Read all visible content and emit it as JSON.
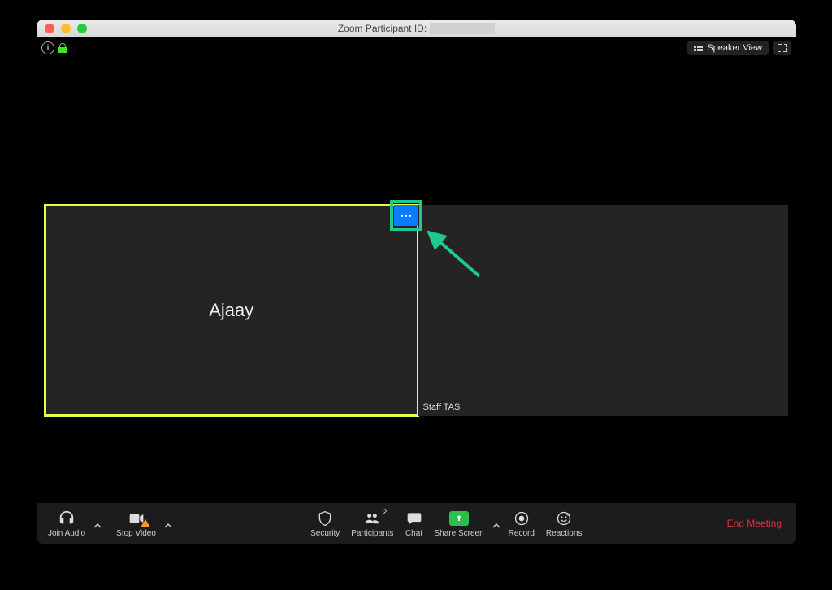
{
  "window": {
    "title_prefix": "Zoom Participant ID:"
  },
  "topbar": {
    "speaker_view_label": "Speaker View"
  },
  "participants": {
    "active": {
      "name": "Ajaay"
    },
    "other": {
      "name": "Staff TAS"
    },
    "count": "2"
  },
  "toolbar": {
    "join_audio": "Join Audio",
    "stop_video": "Stop Video",
    "security": "Security",
    "participants": "Participants",
    "chat": "Chat",
    "share_screen": "Share Screen",
    "record": "Record",
    "reactions": "Reactions",
    "end_meeting": "End Meeting"
  }
}
